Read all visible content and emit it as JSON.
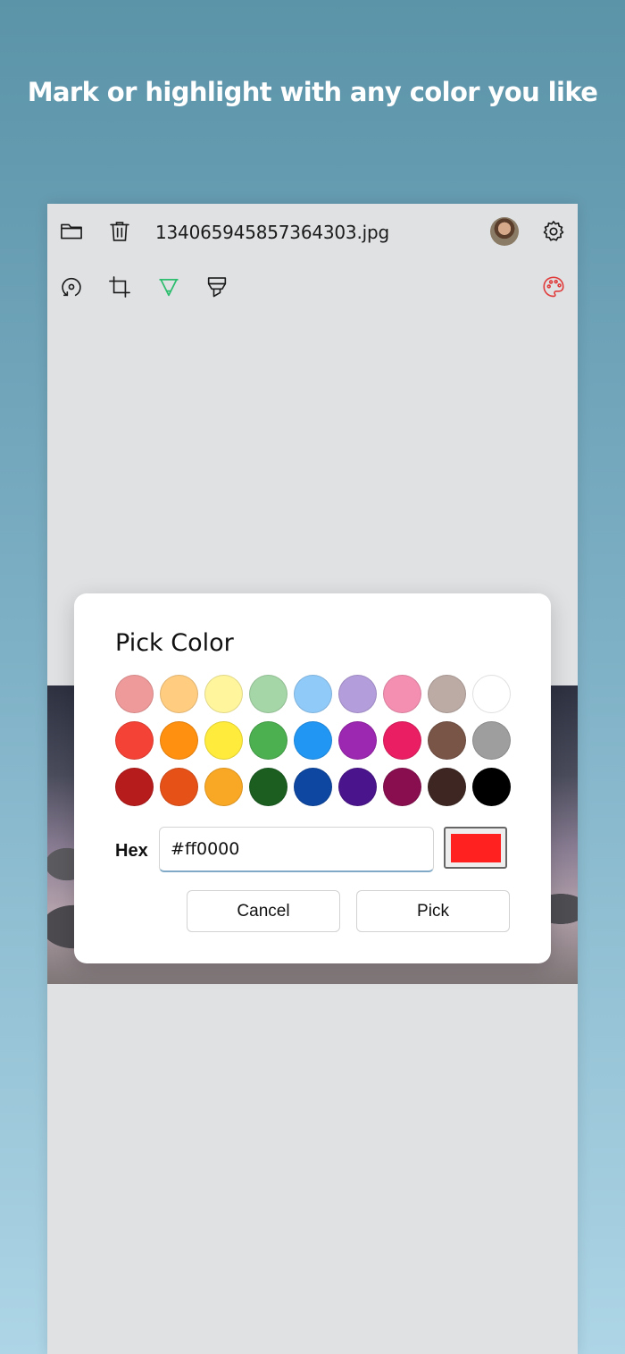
{
  "headline": "Mark or highlight with any color you like",
  "toolbar": {
    "filename": "134065945857364303.jpg",
    "icons": [
      "folder-icon",
      "trash-icon",
      "avatar",
      "gear-icon",
      "rotate-icon",
      "crop-icon",
      "marker-icon",
      "highlighter-icon",
      "palette-icon"
    ],
    "active_tool_color": "#2dbd6e",
    "palette_color": "#e03c3c"
  },
  "dialog": {
    "title": "Pick Color",
    "hex_label": "Hex",
    "hex_value": "#ff0000",
    "preview_color": "#ff2020",
    "cancel_label": "Cancel",
    "pick_label": "Pick",
    "swatches": [
      [
        "#ef9a9a",
        "#ffcc80",
        "#fff59d",
        "#a5d6a7",
        "#90caf9",
        "#b39ddb",
        "#f48fb1",
        "#bcaaa4",
        "#ffffff"
      ],
      [
        "#f44336",
        "#ff9010",
        "#ffeb3b",
        "#4caf50",
        "#2196f3",
        "#9c27b0",
        "#e91e63",
        "#795548",
        "#9e9e9e"
      ],
      [
        "#b71c1c",
        "#e65118",
        "#f9a825",
        "#1b5e20",
        "#0d47a1",
        "#4a148c",
        "#880e4f",
        "#3e2723",
        "#000000"
      ]
    ]
  }
}
